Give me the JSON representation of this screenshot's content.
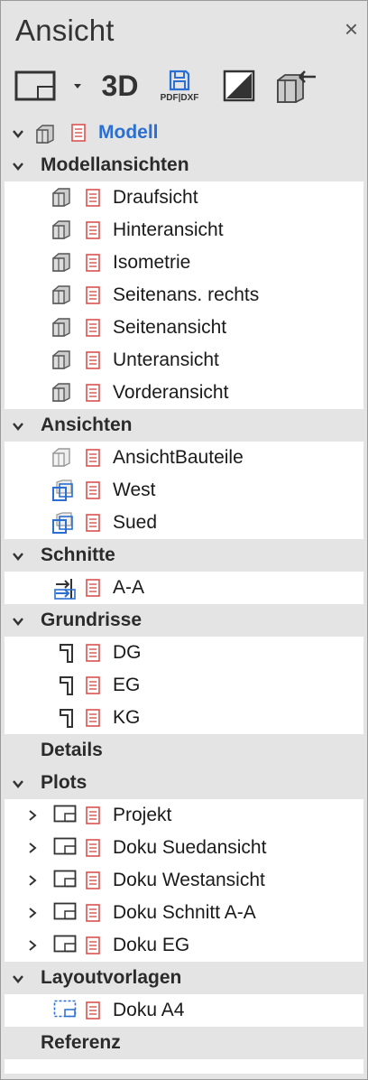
{
  "panel": {
    "title": "Ansicht",
    "close_label": "×"
  },
  "toolbar": {
    "three_d_label": "3D",
    "pdf_label": "PDF|DXF"
  },
  "root": {
    "label": "Modell",
    "color": "#2a6fd1"
  },
  "sections": [
    {
      "id": "modellansichten",
      "label": "Modellansichten",
      "expanded": true,
      "items": [
        "Draufsicht",
        "Hinteransicht",
        "Isometrie",
        "Seitenans. rechts",
        "Seitenansicht",
        "Unteransicht",
        "Vorderansicht"
      ]
    },
    {
      "id": "ansichten",
      "label": "Ansichten",
      "expanded": true,
      "items": [
        "AnsichtBauteile",
        "West",
        "Sued"
      ]
    },
    {
      "id": "schnitte",
      "label": "Schnitte",
      "expanded": true,
      "items": [
        "A-A"
      ]
    },
    {
      "id": "grundrisse",
      "label": "Grundrisse",
      "expanded": true,
      "items": [
        "DG",
        "EG",
        "KG"
      ]
    },
    {
      "id": "details",
      "label": "Details",
      "expanded": false,
      "items": []
    },
    {
      "id": "plots",
      "label": "Plots",
      "expanded": true,
      "items": [
        "Projekt",
        "Doku Suedansicht",
        "Doku Westansicht",
        "Doku Schnitt A-A",
        "Doku EG"
      ]
    },
    {
      "id": "layoutvorlagen",
      "label": "Layoutvorlagen",
      "expanded": true,
      "items": [
        "Doku A4"
      ]
    },
    {
      "id": "referenz",
      "label": "Referenz",
      "expanded": false,
      "items": []
    }
  ],
  "colors": {
    "accent": "#2a6fd1",
    "doc_icon": "#d9534f"
  }
}
